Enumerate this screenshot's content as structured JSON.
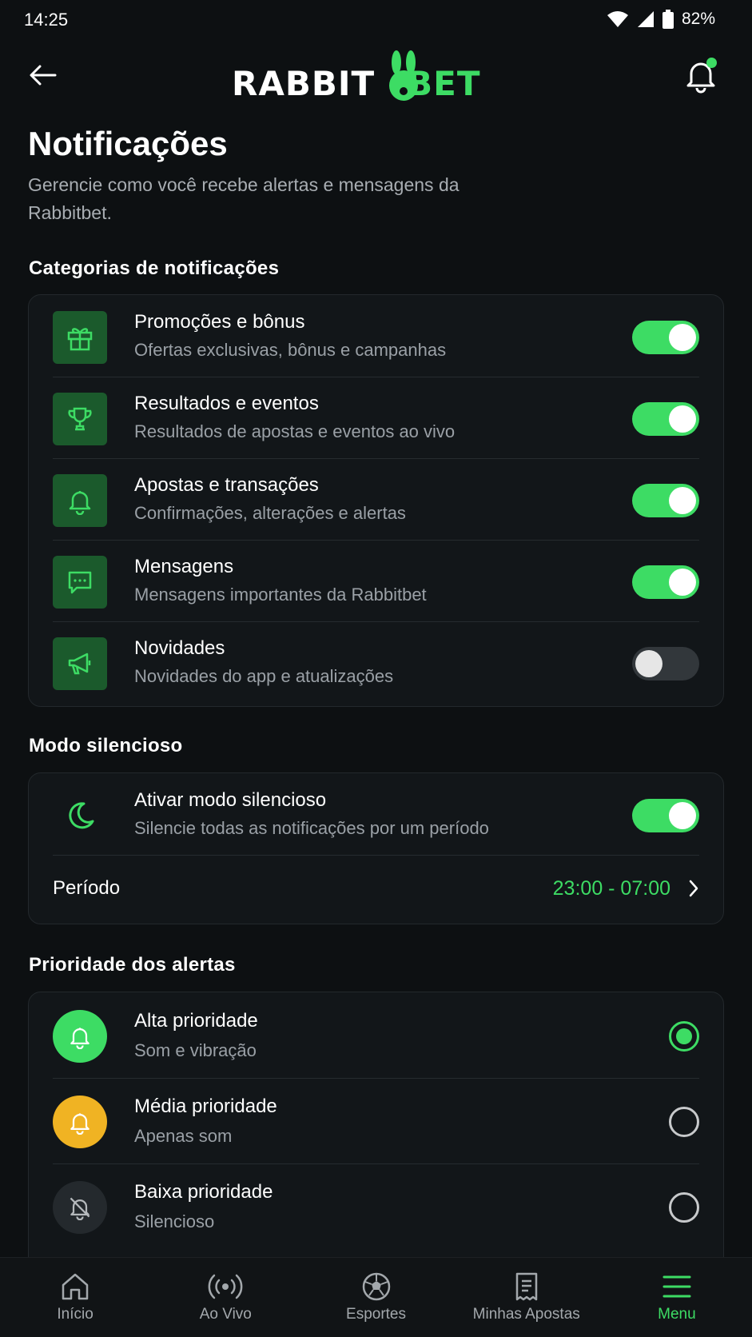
{
  "status": {
    "time": "14:25",
    "battery": "82%"
  },
  "header": {
    "logo_white": "RABBIT",
    "logo_green": "BET",
    "back_icon": "arrow-left-icon",
    "bell_icon": "bell-icon"
  },
  "page": {
    "title": "Notificações",
    "subtitle": "Gerencie como você recebe alertas e mensagens da Rabbitbet."
  },
  "categories": {
    "heading": "Categorias de notificações",
    "items": [
      {
        "title": "Promoções e bônus",
        "subtitle": "Ofertas exclusivas, bônus e campanhas",
        "icon": "gift-icon",
        "enabled": true
      },
      {
        "title": "Resultados e eventos",
        "subtitle": "Resultados de apostas e eventos ao vivo",
        "icon": "trophy-icon",
        "enabled": true
      },
      {
        "title": "Apostas e transações",
        "subtitle": "Confirmações, alterações e alertas",
        "icon": "bell-icon",
        "enabled": true
      },
      {
        "title": "Mensagens",
        "subtitle": "Mensagens importantes da Rabbitbet",
        "icon": "chat-icon",
        "enabled": true
      },
      {
        "title": "Novidades",
        "subtitle": "Novidades do app e atualizações",
        "icon": "megaphone-icon",
        "enabled": false
      }
    ]
  },
  "silent": {
    "heading": "Modo silencioso",
    "title": "Ativar modo silencioso",
    "subtitle": "Silencie todas as notificações por um período",
    "enabled": true,
    "period_label": "Período",
    "period_value": "23:00 - 07:00"
  },
  "priority": {
    "heading": "Prioridade dos alertas",
    "items": [
      {
        "title": "Alta prioridade",
        "subtitle": "Som e vibração",
        "color": "#3ddc64",
        "selected": true
      },
      {
        "title": "Média prioridade",
        "subtitle": "Apenas som",
        "color": "#f0b323",
        "selected": false
      },
      {
        "title": "Baixa prioridade",
        "subtitle": "Silencioso",
        "color": "#24292d",
        "selected": false
      }
    ]
  },
  "nav": [
    {
      "label": "Início",
      "icon": "home-icon"
    },
    {
      "label": "Ao Vivo",
      "icon": "live-icon"
    },
    {
      "label": "Esportes",
      "icon": "soccer-ball-icon"
    },
    {
      "label": "Minhas Apostas",
      "icon": "ticket-icon"
    },
    {
      "label": "Menu",
      "icon": "menu-icon",
      "active": true
    }
  ],
  "colors": {
    "accent": "#3ddc64",
    "background": "#0d1012",
    "card": "#121619",
    "warning": "#f0b323"
  }
}
